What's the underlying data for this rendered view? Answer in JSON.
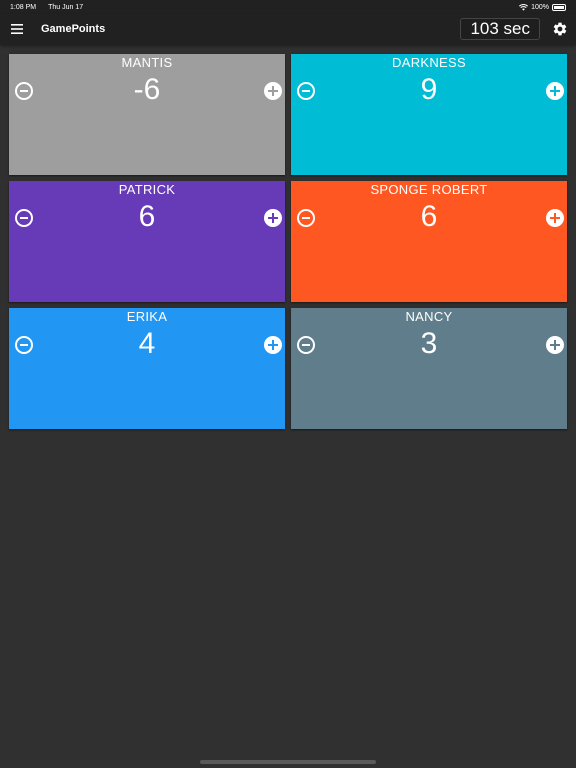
{
  "status": {
    "time": "1:08 PM",
    "date": "Thu Jun 17",
    "battery": "100%"
  },
  "app": {
    "title": "GamePoints",
    "timer": "103 sec"
  },
  "players": [
    {
      "name": "MANTIS",
      "score": "-6",
      "color": "#9e9e9e"
    },
    {
      "name": "DARKNESS",
      "score": "9",
      "color": "#00bcd4"
    },
    {
      "name": "PATRICK",
      "score": "6",
      "color": "#673ab7"
    },
    {
      "name": "SPONGE ROBERT",
      "score": "6",
      "color": "#ff5722"
    },
    {
      "name": "ERIKA",
      "score": "4",
      "color": "#2196f3"
    },
    {
      "name": "NANCY",
      "score": "3",
      "color": "#607d8b"
    }
  ],
  "icons": {
    "menu": "menu-icon",
    "settings": "gear-icon",
    "decrement": "minus-circle-icon",
    "increment": "plus-circle-icon"
  }
}
